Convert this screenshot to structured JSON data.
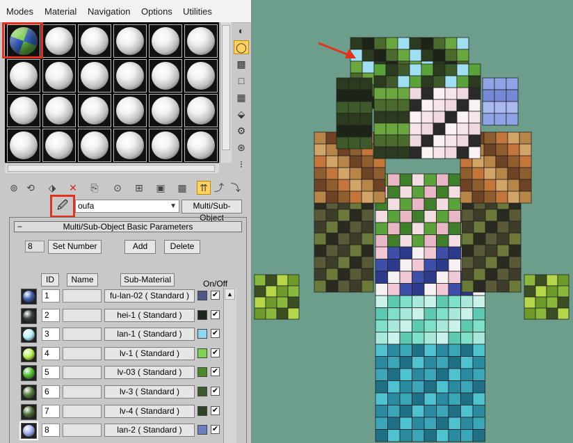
{
  "menu": [
    "Modes",
    "Material",
    "Navigation",
    "Options",
    "Utilities"
  ],
  "material_name": "oufa",
  "material_type_button": "Multi/Sub-Object",
  "rollout": {
    "collapse_symbol": "−",
    "title": "Multi/Sub-Object Basic Parameters",
    "count": "8",
    "set_number_label": "Set Number",
    "add_label": "Add",
    "delete_label": "Delete",
    "col_id": "ID",
    "col_name": "Name",
    "col_submaterial": "Sub-Material",
    "col_onoff": "On/Off"
  },
  "submaterials": [
    {
      "id": "1",
      "name": "",
      "material": "fu-lan-02 ( Standard )",
      "color": "#4d5a86",
      "ball": "#3d5fb0",
      "on": "✔"
    },
    {
      "id": "2",
      "name": "",
      "material": "hei-1 ( Standard )",
      "color": "#1f2420",
      "ball": "#34403a",
      "on": "✔"
    },
    {
      "id": "3",
      "name": "",
      "material": "lan-1 ( Standard )",
      "color": "#8fd6f2",
      "ball": "#b9f1ff",
      "on": "✔"
    },
    {
      "id": "4",
      "name": "",
      "material": "lv-1 ( Standard )",
      "color": "#7dd34e",
      "ball": "#b8f24e",
      "on": "✔"
    },
    {
      "id": "5",
      "name": "",
      "material": "lv-03 ( Standard )",
      "color": "#4b8a2a",
      "ball": "#4fbf2c",
      "on": "✔"
    },
    {
      "id": "6",
      "name": "",
      "material": "lv-3 ( Standard )",
      "color": "#3c5a2c",
      "ball": "#557a3a",
      "on": "✔"
    },
    {
      "id": "7",
      "name": "",
      "material": "lv-4 ( Standard )",
      "color": "#2e4226",
      "ball": "#4b6a34",
      "on": "✔"
    },
    {
      "id": "8",
      "name": "",
      "material": "lan-2 ( Standard )",
      "color": "#6c7fc0",
      "ball": "#9fb1f0",
      "on": "✔"
    }
  ],
  "sidebar_icons": [
    "sample-type-icon",
    "backlight-icon",
    "background-icon",
    "sample-uv-tiling-icon",
    "video-color-check-icon",
    "make-preview-icon",
    "options-icon",
    "select-by-material-icon",
    "material-navigator-icon"
  ],
  "toolbar_icons": [
    "get-material-icon",
    "put-to-scene-icon",
    "assign-to-selection-icon",
    "reset-map-icon",
    "copy-material-icon",
    "make-unique-icon",
    "put-to-library-icon",
    "material-id-channel-icon",
    "show-map-in-viewport-icon",
    "show-end-result-icon",
    "go-to-parent-icon",
    "go-forward-to-sibling-icon"
  ],
  "accent_colors": {
    "annotation_red": "#e2321b",
    "active_toggle": "#ffd25f",
    "viewport_bg": "#6d9e8c"
  }
}
